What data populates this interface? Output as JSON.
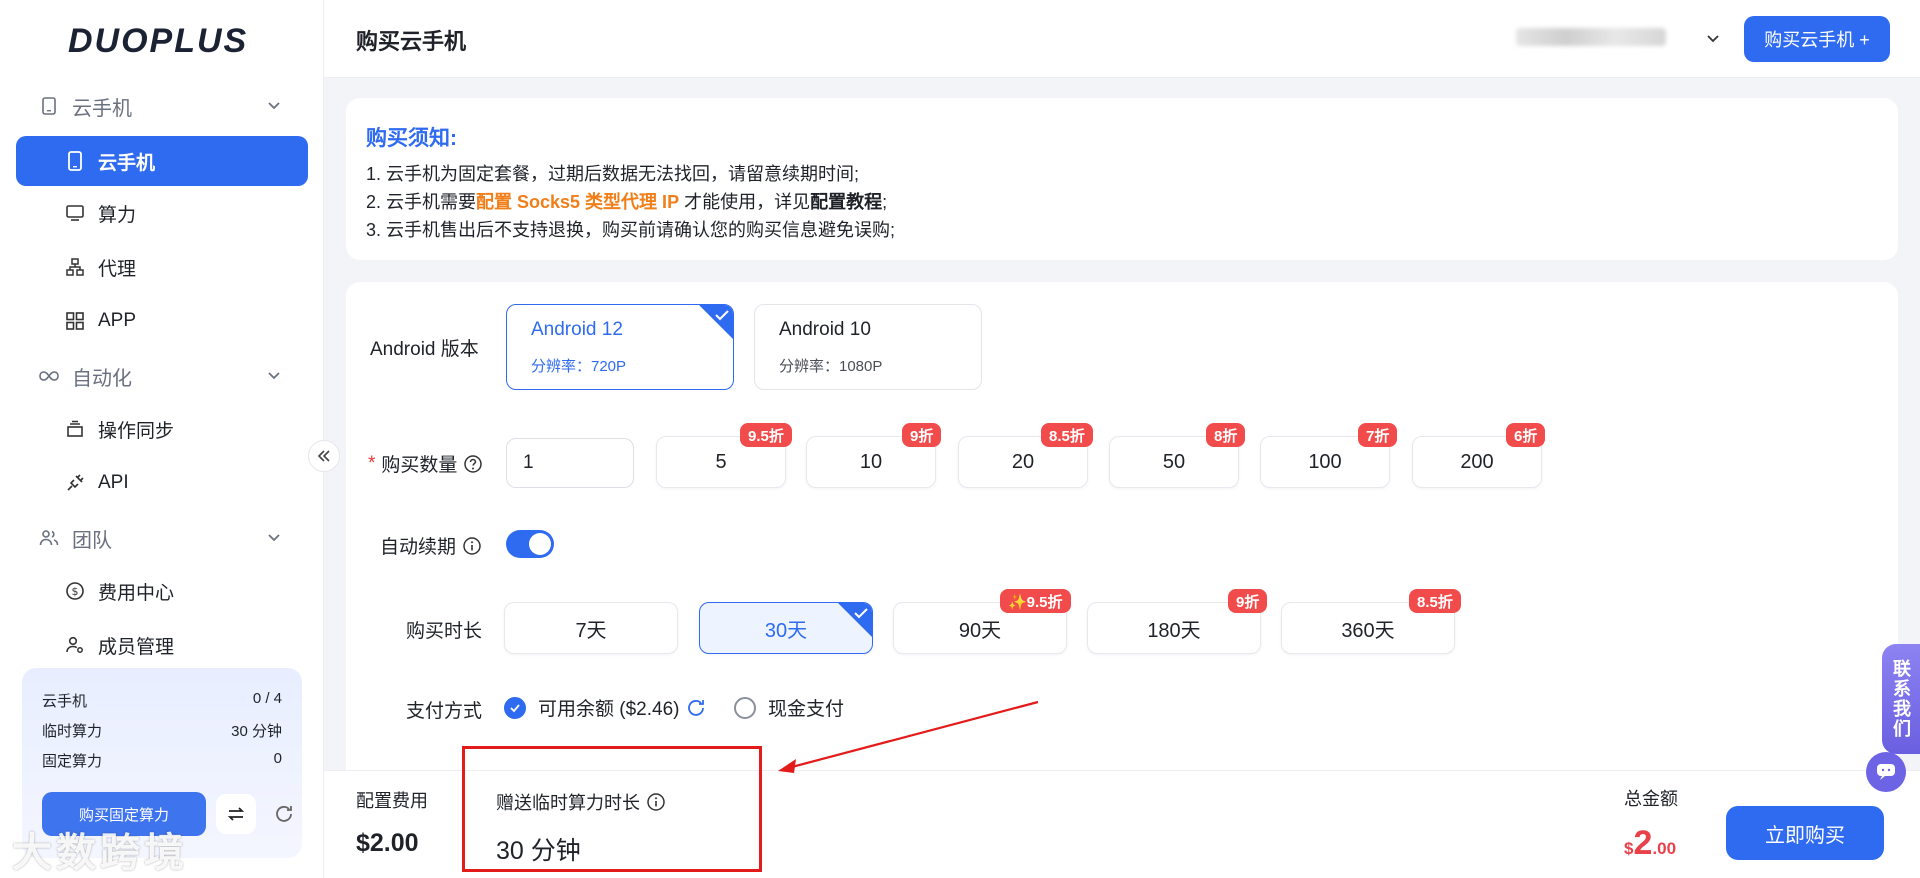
{
  "sidebar": {
    "logo": "DUOPLUS",
    "groups": [
      {
        "label": "云手机"
      },
      {
        "label": "自动化"
      },
      {
        "label": "团队"
      }
    ],
    "items": [
      {
        "label": "云手机"
      },
      {
        "label": "算力"
      },
      {
        "label": "代理"
      },
      {
        "label": "APP"
      },
      {
        "label": "操作同步"
      },
      {
        "label": "API"
      },
      {
        "label": "费用中心"
      },
      {
        "label": "成员管理"
      }
    ],
    "quota": {
      "rows": [
        {
          "label": "云手机",
          "value": "0 / 4"
        },
        {
          "label": "临时算力",
          "value": "30 分钟"
        },
        {
          "label": "固定算力",
          "value": "0"
        }
      ],
      "buy_label": "购买固定算力"
    },
    "watermark": "大数跨境"
  },
  "header": {
    "title": "购买云手机",
    "buy_label": "购买云手机 +"
  },
  "notice": {
    "title": "购买须知:",
    "line1": "1. 云手机为固定套餐，过期后数据无法找回，请留意续期时间;",
    "line2_prefix": "2. 云手机需要",
    "line2_highlight": "配置 Socks5 类型代理 IP",
    "line2_mid": " 才能使用，详见",
    "line2_link": "配置教程",
    "line2_suffix": ";",
    "line3": "3. 云手机售出后不支持退换，购买前请确认您的购买信息避免误购;"
  },
  "form": {
    "android_label": "Android 版本",
    "versions": [
      {
        "name": "Android 12",
        "res": "分辨率：720P",
        "selected": true
      },
      {
        "name": "Android 10",
        "res": "分辨率：1080P",
        "selected": false
      }
    ],
    "qty_label": "购买数量",
    "qty_value": "1",
    "qty_options": [
      {
        "value": "5",
        "badge": "9.5折"
      },
      {
        "value": "10",
        "badge": "9折"
      },
      {
        "value": "20",
        "badge": "8.5折"
      },
      {
        "value": "50",
        "badge": "8折"
      },
      {
        "value": "100",
        "badge": "7折"
      },
      {
        "value": "200",
        "badge": "6折"
      }
    ],
    "renew_label": "自动续期",
    "renew_on": true,
    "duration_label": "购买时长",
    "durations": [
      {
        "value": "7天",
        "badge": "",
        "selected": false
      },
      {
        "value": "30天",
        "badge": "",
        "selected": true
      },
      {
        "value": "90天",
        "badge": "✨9.5折",
        "selected": false
      },
      {
        "value": "180天",
        "badge": "9折",
        "selected": false
      },
      {
        "value": "360天",
        "badge": "8.5折",
        "selected": false
      }
    ],
    "pay_label": "支付方式",
    "pay_balance": "可用余额 ($2.46)",
    "pay_cash": "现金支付"
  },
  "footer": {
    "config_label": "配置费用",
    "config_value": "$2.00",
    "gift_label": "赠送临时算力时长",
    "gift_value": "30 分钟",
    "total_label": "总金额",
    "total_currency": "$",
    "total_int": "2",
    "total_cents": ".00",
    "buy_now": "立即购买"
  },
  "contact": "联系我们",
  "colors": {
    "primary": "#2f6bf0",
    "badge": "#f14b4b",
    "highlight": "#f07f1a",
    "annotation": "#e31b1b"
  }
}
